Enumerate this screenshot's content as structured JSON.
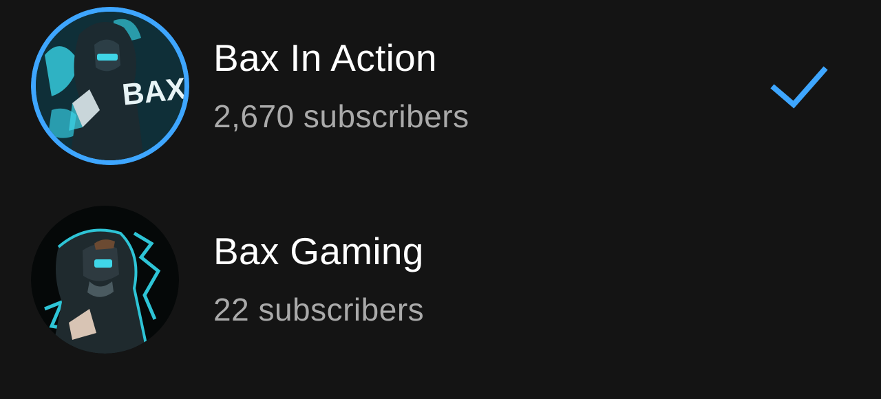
{
  "accounts": [
    {
      "name": "Bax In Action",
      "subscribers": "2,670 subscribers",
      "selected": true,
      "avatar_text": "BAX AC",
      "avatar_ring_color": "#3ea6ff"
    },
    {
      "name": "Bax Gaming",
      "subscribers": "22 subscribers",
      "selected": false
    }
  ],
  "icons": {
    "selected": "checkmark-icon"
  },
  "colors": {
    "background": "#141414",
    "title": "#ffffff",
    "secondary_text": "#aaaaaa",
    "accent": "#3ea6ff",
    "avatar_teal": "#2ec4d6"
  }
}
